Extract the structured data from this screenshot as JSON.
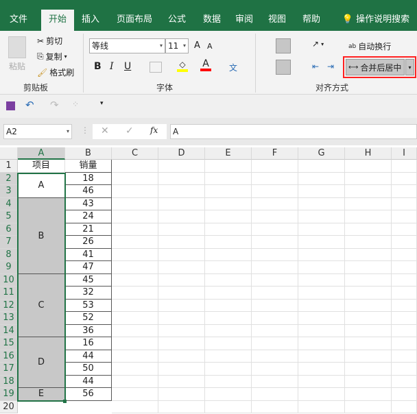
{
  "tabs": [
    "文件",
    "开始",
    "插入",
    "页面布局",
    "公式",
    "数据",
    "审阅",
    "视图",
    "帮助"
  ],
  "active_tab": "开始",
  "tell_me": "操作说明搜索",
  "clipboard": {
    "paste": "粘贴",
    "cut": "剪切",
    "copy": "复制",
    "format_painter": "格式刷",
    "group": "剪贴板"
  },
  "font": {
    "name": "等线",
    "size": "11",
    "bold": "B",
    "italic": "I",
    "underline": "U",
    "group": "字体",
    "grow": "A",
    "shrink": "A",
    "font_color": "A",
    "phonetic": "文"
  },
  "alignment": {
    "wrap_text": "自动换行",
    "merge_center": "合并后居中",
    "group": "对齐方式"
  },
  "colors": {
    "ribbon_green": "#1f7244",
    "highlight_yellow": "#ffff00",
    "font_red": "#ff0000",
    "selection_green": "#217346",
    "annotation_red": "#ff2020"
  },
  "formula_bar": {
    "name_box": "A2",
    "fx": "fx",
    "value": "A"
  },
  "columns": [
    "A",
    "B",
    "C",
    "D",
    "E",
    "F",
    "G",
    "H",
    "I"
  ],
  "rows": [
    "1",
    "2",
    "3",
    "4",
    "5",
    "6",
    "7",
    "8",
    "9",
    "10",
    "11",
    "12",
    "13",
    "14",
    "15",
    "16",
    "17",
    "18",
    "19",
    "20"
  ],
  "header": {
    "a": "项目",
    "b": "销量"
  },
  "merged_a": [
    {
      "label": "A",
      "rows": [
        2,
        3
      ]
    },
    {
      "label": "B",
      "rows": [
        4,
        9
      ]
    },
    {
      "label": "C",
      "rows": [
        10,
        14
      ]
    },
    {
      "label": "D",
      "rows": [
        15,
        18
      ]
    },
    {
      "label": "E",
      "rows": [
        19,
        19
      ]
    }
  ],
  "sales": [
    "18",
    "46",
    "43",
    "24",
    "21",
    "26",
    "41",
    "47",
    "45",
    "32",
    "53",
    "52",
    "36",
    "16",
    "44",
    "50",
    "44",
    "56"
  ]
}
